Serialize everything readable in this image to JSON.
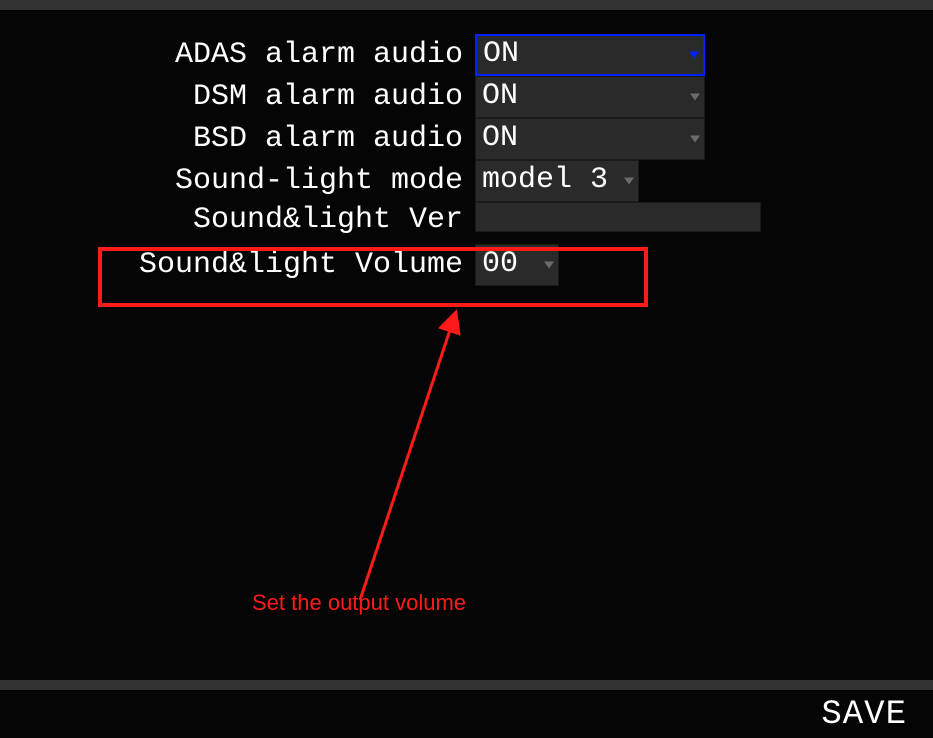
{
  "settings": {
    "rows": [
      {
        "label": "ADAS alarm audio",
        "value": "ON",
        "type": "dropdown",
        "active": true
      },
      {
        "label": "DSM alarm audio",
        "value": "ON",
        "type": "dropdown",
        "active": false
      },
      {
        "label": "BSD alarm audio",
        "value": "ON",
        "type": "dropdown",
        "active": false
      },
      {
        "label": "Sound-light mode",
        "value": "model 3",
        "type": "dropdown",
        "active": false
      },
      {
        "label": "Sound&light Ver",
        "value": "",
        "type": "readonly",
        "active": false
      },
      {
        "label": "Sound&light Volume",
        "value": "00",
        "type": "dropdown",
        "active": false,
        "volume": true
      }
    ]
  },
  "annotation": {
    "text": "Set the output volume"
  },
  "footer": {
    "save_label": "SAVE"
  }
}
